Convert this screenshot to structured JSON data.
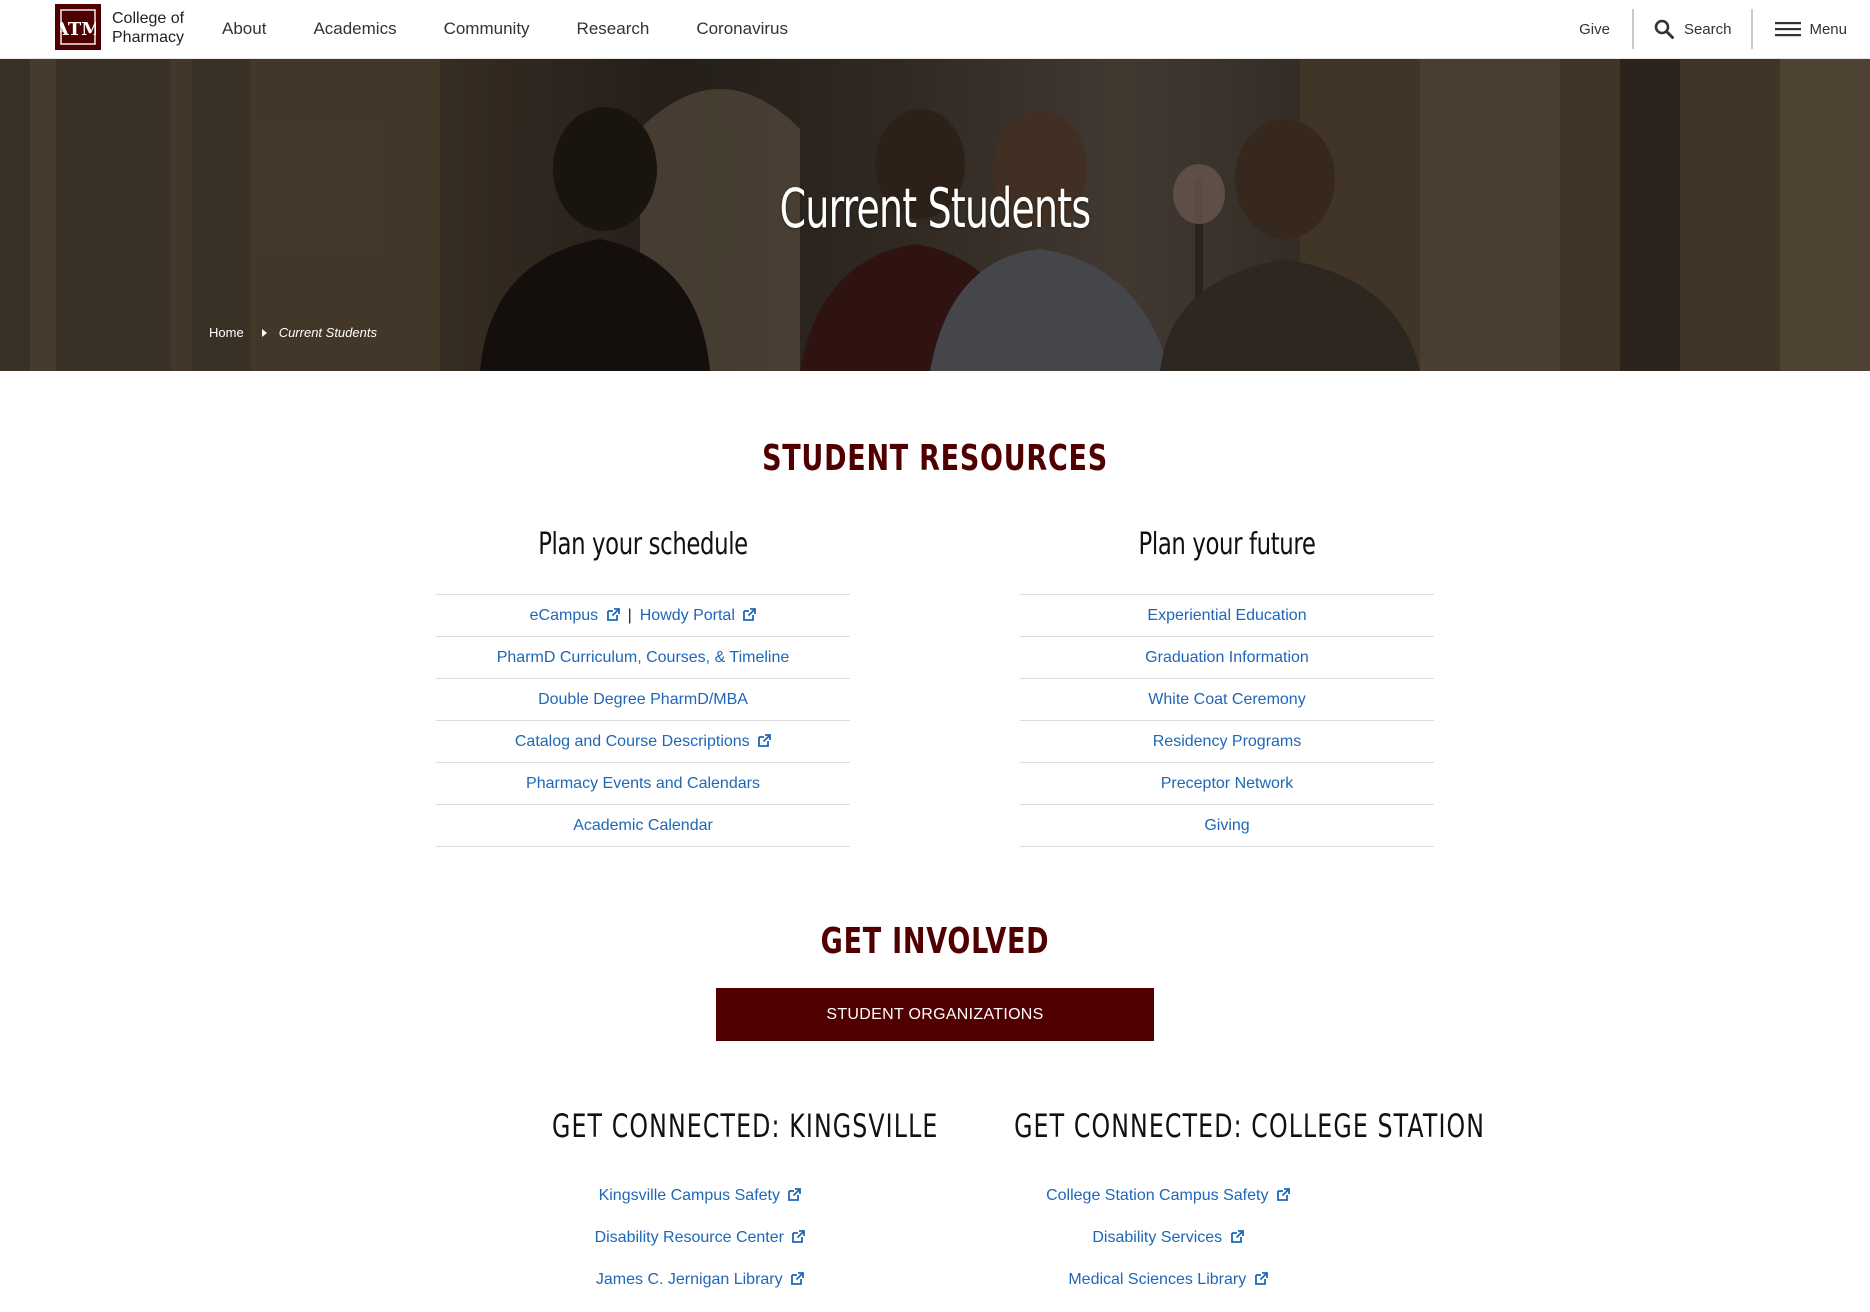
{
  "header": {
    "logo_text": "ATM",
    "college_line1": "College of",
    "college_line2": "Pharmacy",
    "nav": [
      "About",
      "Academics",
      "Community",
      "Research",
      "Coronavirus"
    ],
    "give": "Give",
    "search": "Search",
    "menu": "Menu"
  },
  "hero": {
    "title": "Current Students",
    "breadcrumb": {
      "home": "Home",
      "current": "Current Students"
    }
  },
  "student_resources": {
    "title": "STUDENT RESOURCES",
    "schedule": {
      "heading": "Plan your schedule",
      "links": [
        {
          "label": "eCampus",
          "external": true,
          "label2": "Howdy Portal",
          "external2": true
        },
        {
          "label": "PharmD Curriculum, Courses, & Timeline",
          "external": false
        },
        {
          "label": "Double Degree PharmD/MBA",
          "external": false
        },
        {
          "label": "Catalog and Course Descriptions",
          "external": true
        },
        {
          "label": "Pharmacy Events and Calendars",
          "external": false
        },
        {
          "label": "Academic Calendar",
          "external": false
        }
      ]
    },
    "future": {
      "heading": "Plan your future",
      "links": [
        {
          "label": "Experiential Education"
        },
        {
          "label": "Graduation Information"
        },
        {
          "label": "White Coat Ceremony"
        },
        {
          "label": "Residency Programs"
        },
        {
          "label": "Preceptor Network"
        },
        {
          "label": "Giving"
        }
      ]
    }
  },
  "get_involved": {
    "title": "GET INVOLVED",
    "button": "STUDENT ORGANIZATIONS"
  },
  "kingsville": {
    "heading": "GET CONNECTED: KINGSVILLE",
    "links": [
      "Kingsville Campus Safety",
      "Disability Resource Center",
      "James C. Jernigan Library"
    ]
  },
  "college_station": {
    "heading": "GET CONNECTED: COLLEGE STATION",
    "links": [
      "College Station Campus Safety",
      "Disability Services",
      "Medical Sciences Library"
    ]
  },
  "colors": {
    "maroon": "#500000",
    "link_blue": "#1e67b8"
  }
}
